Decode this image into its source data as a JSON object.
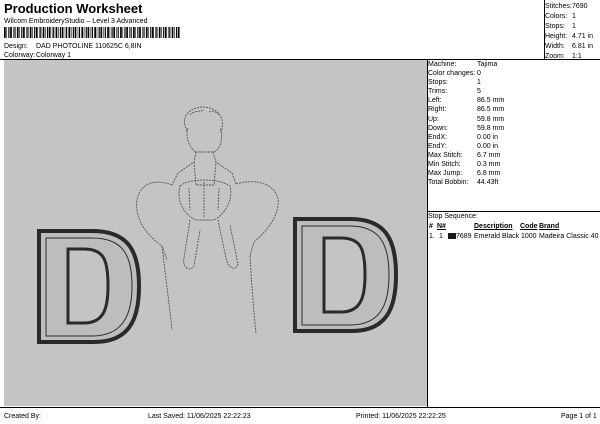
{
  "header": {
    "title": "Production Worksheet",
    "subtitle": "Wilcom EmbroideryStudio – Level 3 Advanced",
    "design_label": "Design:",
    "design_value": "DAD PHOTOLINE 110625C 6,8IN",
    "colorway_label": "Colorway:",
    "colorway_value": "Colorway 1"
  },
  "stats": [
    {
      "label": "Stitches:",
      "value": "7690"
    },
    {
      "label": "Colors:",
      "value": "1"
    },
    {
      "label": "Stops:",
      "value": "1"
    },
    {
      "label": "Height:",
      "value": "4.71 in"
    },
    {
      "label": "Width:",
      "value": "6.81 in"
    },
    {
      "label": "Zoom:",
      "value": "1:1"
    }
  ],
  "machine_info": [
    {
      "label": "Machine:",
      "value": "Tajima"
    },
    {
      "label": "Color changes:",
      "value": "0"
    },
    {
      "label": "Stops:",
      "value": "1"
    },
    {
      "label": "Trims:",
      "value": "5"
    },
    {
      "label": "Left:",
      "value": "86.5 mm"
    },
    {
      "label": "Right:",
      "value": "86.5 mm"
    },
    {
      "label": "Up:",
      "value": "59.8 mm"
    },
    {
      "label": "Down:",
      "value": "59.8 mm"
    },
    {
      "label": "EndX:",
      "value": "0.00 in"
    },
    {
      "label": "EndY:",
      "value": "0.00 in"
    },
    {
      "label": "Max Stitch:",
      "value": "6.7 mm"
    },
    {
      "label": "Min Stitch:",
      "value": "0.3 mm"
    },
    {
      "label": "Max Jump:",
      "value": "6.8 mm"
    },
    {
      "label": "Total Bobbin:",
      "value": "44.43ft"
    }
  ],
  "stop_sequence": {
    "title": "Stop Sequence:",
    "columns": [
      "#",
      "N#",
      "Description",
      "Code",
      "Brand"
    ],
    "rows": [
      {
        "num": "1.",
        "n": "1",
        "stitches": "7689",
        "description": "Emerald Black",
        "code": "1000",
        "brand": "Madeira Classic 40",
        "color": "#1a1a1a"
      }
    ]
  },
  "design_preview": {
    "colors": {
      "background": "#c4c4c4",
      "fill": "#bdbdbd",
      "outline": "#2a2a2a",
      "sketch": "#555555"
    }
  },
  "footer": {
    "created_by": "Created By:",
    "last_saved": "Last Saved: 11/06/2025 22:22:23",
    "printed": "Printed: 11/06/2025 22:22:25",
    "page": "Page 1 of 1"
  }
}
